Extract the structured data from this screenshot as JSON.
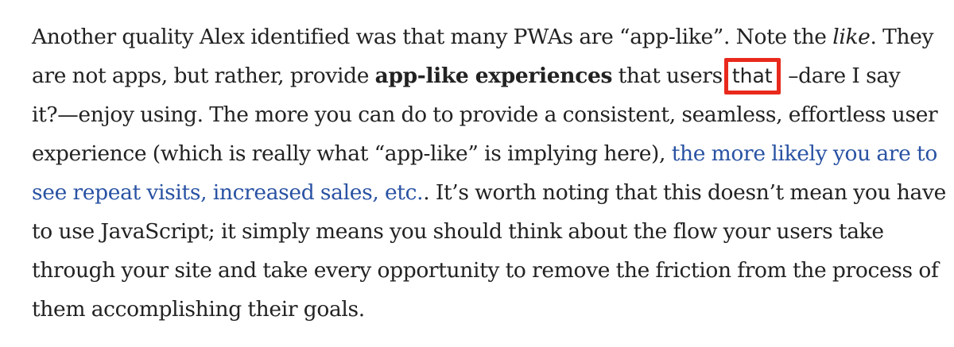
{
  "paragraph": {
    "l1_a": "Another quality Alex identified was that many PWAs are “app-like”. Note the ",
    "l1_em": "like",
    "l1_b": ". They",
    "l2_a": "are not apps, but rather, provide ",
    "l2_strong": "app-like experiences",
    "l2_b": " that users",
    "highlighted_word": "that",
    "l2_c": " –dare I say",
    "l3": "it?—enjoy using. The more you can do to provide a consistent, seamless, effortless user",
    "l4_a": "experience (which is really what “app-like” is implying here), ",
    "link_line1": "the more likely you are to",
    "link_line2": "see repeat visits, increased sales, etc.",
    "l5_b": ". It’s worth noting that this doesn’t mean you have",
    "l6": "to use JavaScript; it simply means you should think about the flow your users take",
    "l7": "through your site and take every opportunity to remove the friction from the process of",
    "l8": "them accomplishing their goals."
  },
  "colors": {
    "text": "#222222",
    "link": "#2952a3",
    "highlight_border": "#e8291c",
    "background": "#ffffff"
  }
}
